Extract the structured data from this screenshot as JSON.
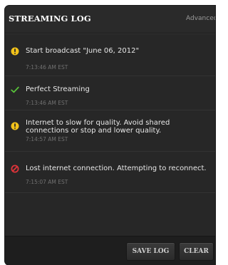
{
  "header": {
    "title": "STREAMING LOG",
    "advanced_label": "Advanced"
  },
  "log": [
    {
      "type": "warning",
      "icon": "warning-icon",
      "message": "Start broadcast \"June 06, 2012\"",
      "time": "7:13:46 AM EST"
    },
    {
      "type": "success",
      "icon": "check-icon",
      "message": "Perfect Streaming",
      "time": "7:13:46 AM EST"
    },
    {
      "type": "warning",
      "icon": "warning-icon",
      "message": "Internet to slow for quality. Avoid shared connections or stop and lower quality.",
      "time": "7:14:57 AM EST"
    },
    {
      "type": "error",
      "icon": "error-icon",
      "message": "Lost internet connection. Attempting to reconnect.",
      "time": "7:15:07 AM EST"
    }
  ],
  "footer": {
    "save_label": "SAVE LOG",
    "clear_label": "CLEAR"
  },
  "colors": {
    "warning": "#f2c21a",
    "success": "#58c23a",
    "error": "#e0343a",
    "panel": "#262626"
  }
}
